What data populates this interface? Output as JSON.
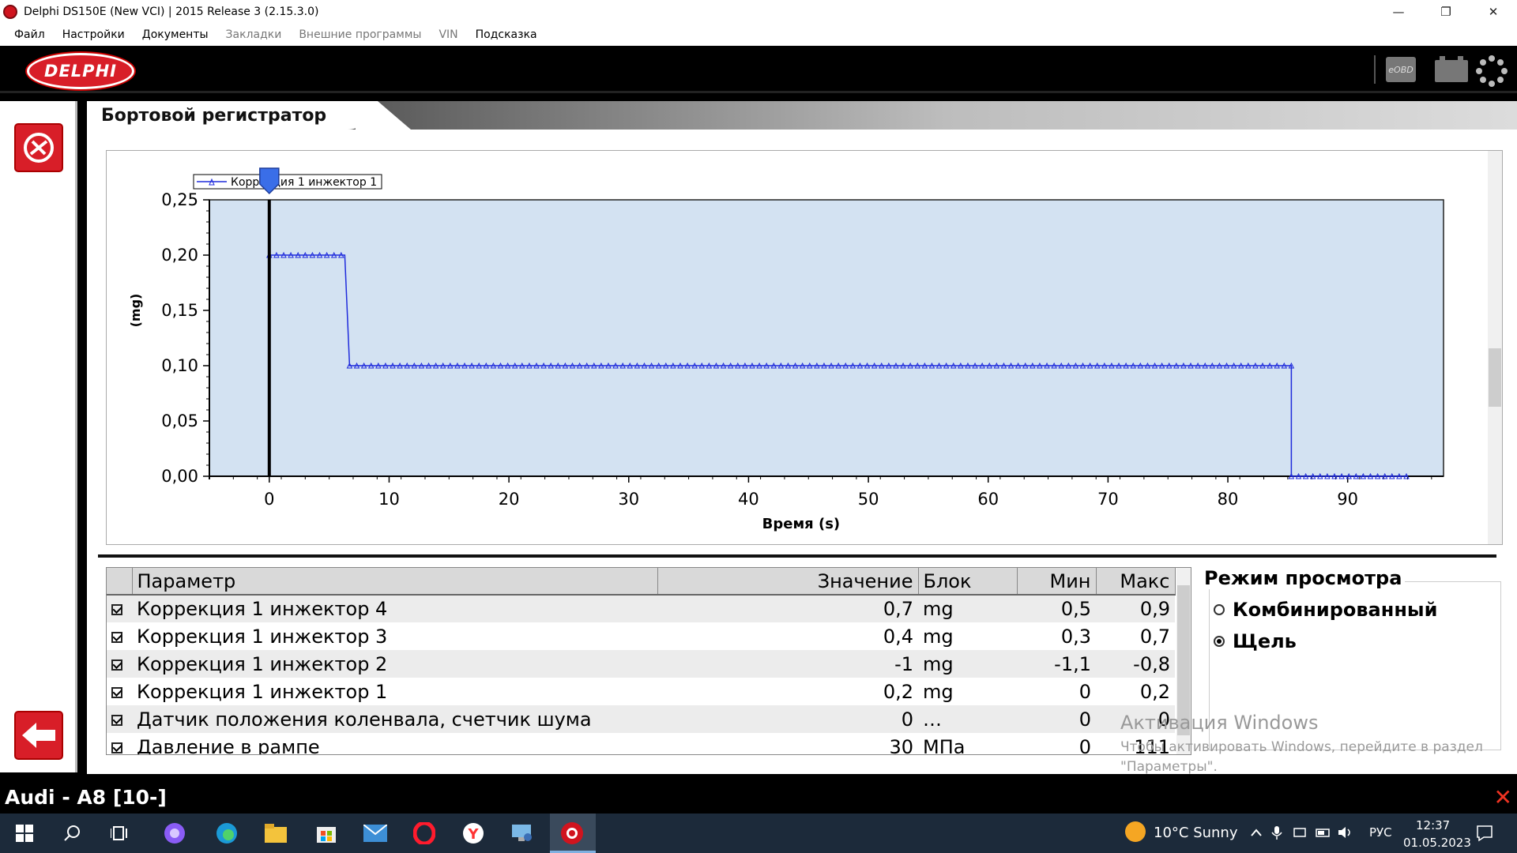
{
  "window": {
    "title": "Delphi DS150E (New VCI) | 2015 Release 3 (2.15.3.0)",
    "minimize": "—",
    "maximize": "❐",
    "close": "✕"
  },
  "menu": [
    {
      "label": "Файл"
    },
    {
      "label": "Настройки"
    },
    {
      "label": "Документы"
    },
    {
      "label": "Закладки"
    },
    {
      "label": "Внешние программы"
    },
    {
      "label": "VIN"
    },
    {
      "label": "Подсказка"
    }
  ],
  "brand": {
    "logo_text": "DELPHI",
    "eobd": "eOBD"
  },
  "page": {
    "title": "Бортовой регистратор"
  },
  "chart_data": {
    "type": "line",
    "title": "",
    "xlabel": "Время (s)",
    "ylabel": "(mg)",
    "xlim": [
      -5,
      98
    ],
    "ylim": [
      0,
      0.25
    ],
    "xticks": [
      0,
      10,
      20,
      30,
      40,
      50,
      60,
      70,
      80,
      90
    ],
    "yticks": [
      "0,00",
      "0,05",
      "0,10",
      "0,15",
      "0,20",
      "0,25"
    ],
    "grid": false,
    "legend_position": "top-left",
    "background_color": "#d3e2f2",
    "cursor_x": 0,
    "series": [
      {
        "name": "Коррекция 1 инжектор 1",
        "color": "#1f2bdc",
        "points": [
          [
            0,
            0.2
          ],
          [
            6.3,
            0.2
          ],
          [
            6.7,
            0.1
          ],
          [
            85.3,
            0.1
          ],
          [
            85.3,
            0
          ],
          [
            95,
            0
          ]
        ]
      }
    ]
  },
  "table": {
    "headers": [
      "Параметр",
      "Значение",
      "Блок",
      "Мин",
      "Макс"
    ],
    "rows": [
      {
        "name": "Коррекция 1 инжектор 4",
        "value": "0,7",
        "unit": "mg",
        "min": "0,5",
        "max": "0,9"
      },
      {
        "name": "Коррекция 1 инжектор 3",
        "value": "0,4",
        "unit": "mg",
        "min": "0,3",
        "max": "0,7"
      },
      {
        "name": "Коррекция 1 инжектор 2",
        "value": "-1",
        "unit": "mg",
        "min": "-1,1",
        "max": "-0,8"
      },
      {
        "name": "Коррекция 1 инжектор 1",
        "value": "0,2",
        "unit": "mg",
        "min": "0",
        "max": "0,2"
      },
      {
        "name": "Датчик положения коленвала, счетчик шума",
        "value": "0",
        "unit": "…",
        "min": "0",
        "max": "0"
      },
      {
        "name": "Давление в рампе",
        "value": "30",
        "unit": "МПа",
        "min": "0",
        "max": "111"
      }
    ]
  },
  "view_mode": {
    "title": "Режим просмотра",
    "options": [
      {
        "label": "Комбинированный",
        "selected": false
      },
      {
        "label": "Щель",
        "selected": true
      }
    ]
  },
  "watermark": {
    "line1": "Активация Windows",
    "line2": "Чтобы активировать Windows, перейдите в раздел",
    "line3": "\"Параметры\"."
  },
  "vehicle": {
    "label": "Audi - A8 [10-]"
  },
  "taskbar": {
    "weather": "10°C  Sunny",
    "lang": "РУС",
    "time": "12:37",
    "date": "01.05.2023"
  }
}
